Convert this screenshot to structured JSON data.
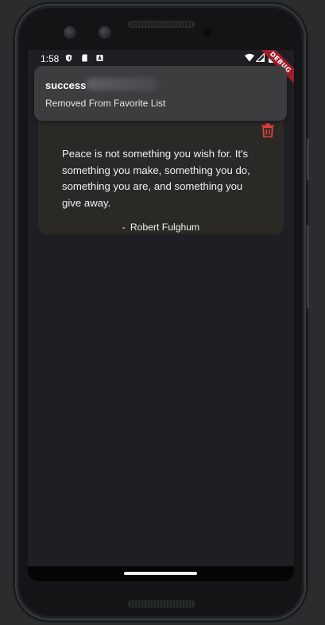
{
  "status_bar": {
    "time": "1:58",
    "icons": [
      "shield-icon",
      "sd-card-icon",
      "a-icon",
      "wifi-icon",
      "signal-icon",
      "battery-icon"
    ]
  },
  "debug_banner": {
    "label": "DEBUG"
  },
  "toast": {
    "title": "success",
    "message": "Removed From Favorite List"
  },
  "quote_card": {
    "text": "Peace is not something you wish for. It's something you make, something you do, something you are, and something you give away.",
    "dash": "-",
    "author": "Robert Fulghum",
    "delete_icon": "trash-icon"
  },
  "colors": {
    "screen_bg": "#1f1f23",
    "card_bg": "#2a2926",
    "accent_red": "#e5413a",
    "toast_bg": "#3e3e42"
  }
}
